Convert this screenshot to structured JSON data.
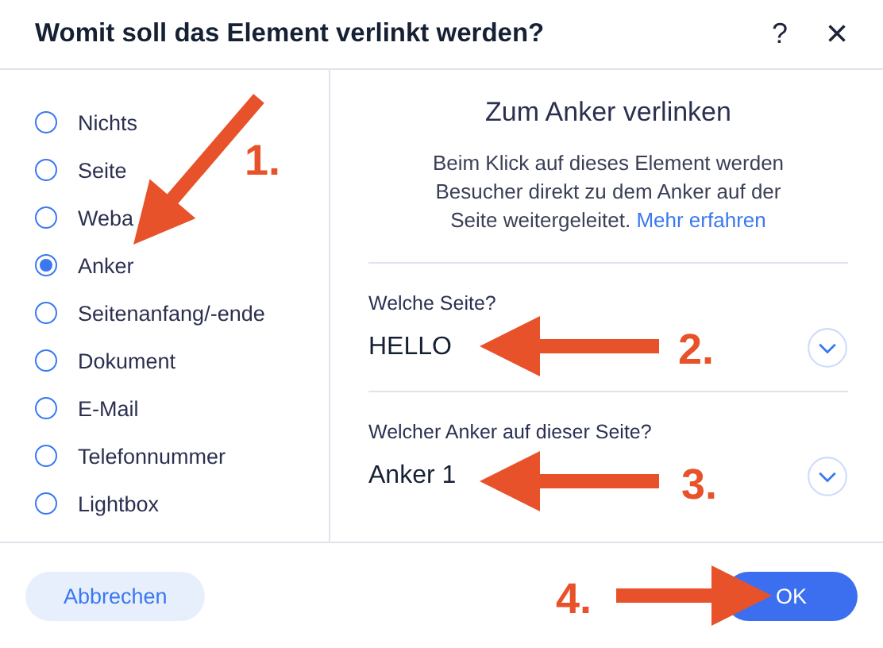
{
  "window": {
    "title": "Womit soll das Element verlinkt werden?",
    "help": "?",
    "close": "×"
  },
  "options": [
    {
      "label": "Nichts",
      "selected": false
    },
    {
      "label": "Seite",
      "selected": false
    },
    {
      "label": "Weba",
      "selected": false
    },
    {
      "label": "Anker",
      "selected": true
    },
    {
      "label": "Seitenanfang/-ende",
      "selected": false
    },
    {
      "label": "Dokument",
      "selected": false
    },
    {
      "label": "E-Mail",
      "selected": false
    },
    {
      "label": "Telefonnummer",
      "selected": false
    },
    {
      "label": "Lightbox",
      "selected": false
    }
  ],
  "panel": {
    "title": "Zum Anker verlinken",
    "description": "Beim Klick auf dieses Element werden Besucher direkt zu dem Anker auf der Seite weitergeleitet.",
    "link": "Mehr erfahren",
    "fields": [
      {
        "label": "Welche Seite?",
        "value": "HELLO"
      },
      {
        "label": "Welcher Anker auf dieser Seite?",
        "value": "Anker 1"
      }
    ]
  },
  "buttons": {
    "cancel": "Abbrechen",
    "ok": "OK"
  },
  "callouts": [
    "1.",
    "2.",
    "3.",
    "4."
  ]
}
